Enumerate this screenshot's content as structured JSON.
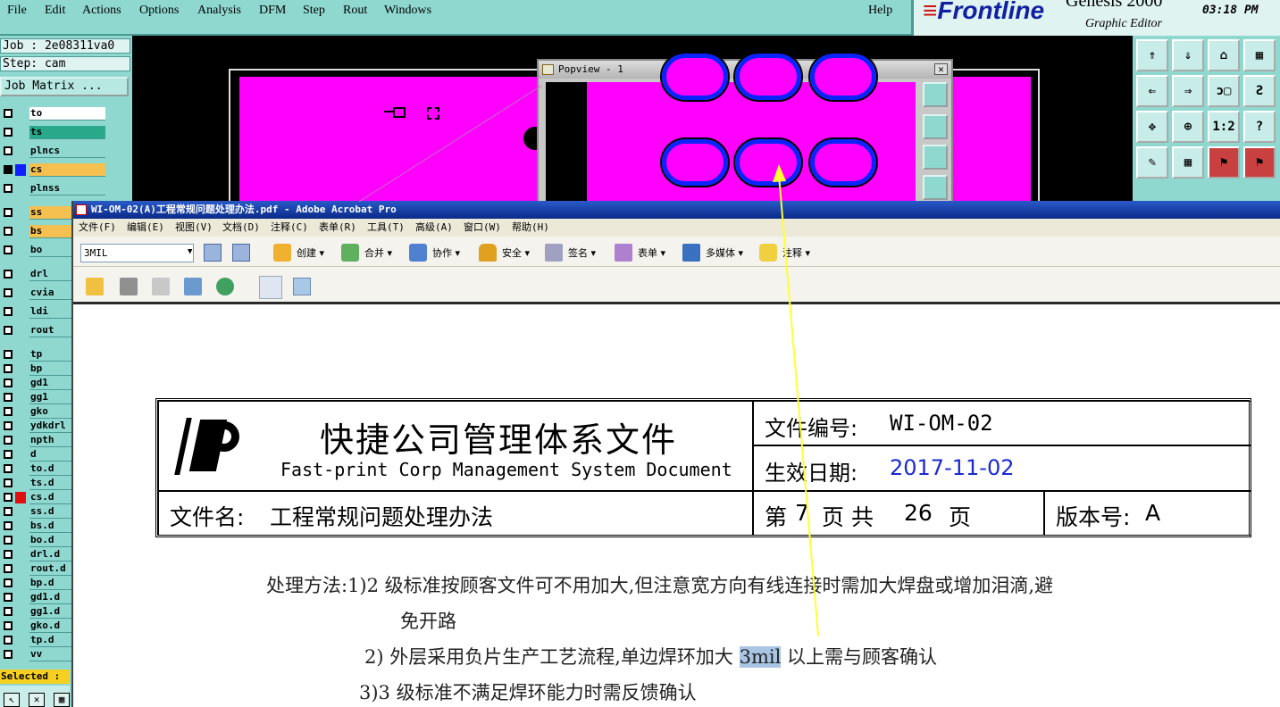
{
  "menubar": {
    "items": [
      "File",
      "Edit",
      "Actions",
      "Options",
      "Analysis",
      "DFM",
      "Step",
      "Rout",
      "Windows"
    ],
    "help": "Help"
  },
  "logo": {
    "brand": "Frontline",
    "product": "Genesis 2000",
    "subtitle": "Graphic Editor",
    "time": "03:18 PM"
  },
  "job": {
    "job_line": "Job : 2e08311va0",
    "step_line": "Step: cam",
    "matrix_button": "Job Matrix ..."
  },
  "layers": [
    "to",
    "ts",
    "plncs",
    "cs",
    "plnss",
    "ss",
    "bs",
    "bo",
    "drl",
    "cvia",
    "ldi",
    "rout",
    "tp",
    "bp",
    "gd1",
    "gg1",
    "gko",
    "ydkdrl",
    "npth",
    "d",
    "to.d",
    "ts.d",
    "cs.d",
    "ss.d",
    "bs.d",
    "bo.d",
    "drl.d",
    "rout.d",
    "bp.d",
    "gd1.d",
    "gg1.d",
    "gko.d",
    "tp.d",
    "vv"
  ],
  "selected_label": "Selected :",
  "popview": {
    "title": "Popview - 1",
    "close": "✕"
  },
  "toolgrid": {
    "labels": [
      "⇑",
      "⇓",
      "⌂",
      "▦",
      "⇐",
      "⇒",
      "ɔ▢",
      "Ƨ",
      "✥",
      "⊕",
      "1:2",
      "?",
      "✎",
      "▦",
      "⚑",
      "⚑"
    ]
  },
  "acrobat": {
    "title": "WI-OM-02(A)工程常规问题处理办法.pdf - Adobe Acrobat Pro",
    "menu": [
      "文件(F)",
      "编辑(E)",
      "视图(V)",
      "文档(D)",
      "注释(C)",
      "表单(R)",
      "工具(T)",
      "高级(A)",
      "窗口(W)",
      "帮助(H)"
    ],
    "search_value": "3MIL",
    "tools": [
      "创建",
      "合并",
      "协作",
      "安全",
      "签名",
      "表单",
      "多媒体",
      "注释"
    ]
  },
  "document": {
    "company_zh": "快捷公司管理体系文件",
    "company_en": "Fast-print Corp Management System Document",
    "doc_no_label": "文件编号:",
    "doc_no": "WI-OM-02",
    "effective_label": "生效日期:",
    "effective_date": "2017-11-02",
    "file_name_label": "文件名:",
    "file_name": "工程常规问题处理办法",
    "page_prefix": "第",
    "page_no": "7",
    "page_mid": "页 共",
    "page_total": "26",
    "page_suffix": "页",
    "version_label": "版本号:",
    "version": "A",
    "line1": "处理方法:1)2 级标准按顾客文件可不用加大,但注意宽方向有线连接时需加大焊盘或增加泪滴,避",
    "line1b": "免开路",
    "line2_pre": "2) 外层采用负片生产工艺流程,单边焊环加大",
    "line2_hl": "3mil",
    "line2_post": "以上需与顾客确认",
    "line3": "3)3 级标准不满足焊环能力时需反馈确认"
  },
  "colors": {
    "genesis_bg": "#8fd8d0",
    "board": "#ff00ff",
    "pad": "#0b24ff",
    "arrow": "#ffff33",
    "date": "#1a2ad0"
  }
}
